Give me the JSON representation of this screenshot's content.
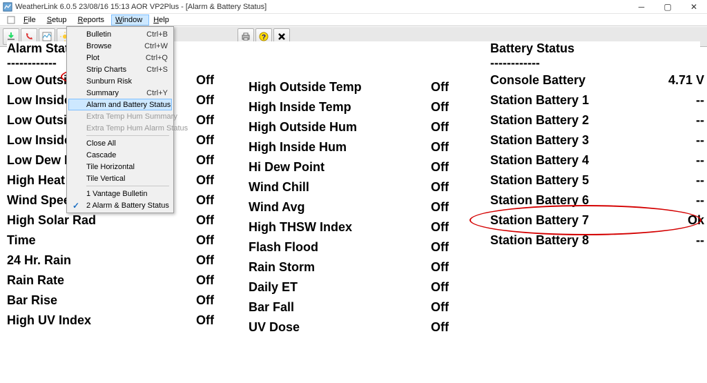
{
  "titlebar": {
    "text": "WeatherLink 6.0.5  23/08/16  15:13  AOR VP2Plus - [Alarm & Battery Status]"
  },
  "menubar": {
    "items": [
      {
        "label": "File",
        "initial": "F"
      },
      {
        "label": "Setup",
        "initial": "S"
      },
      {
        "label": "Reports",
        "initial": "R"
      },
      {
        "label": "Window",
        "initial": "W",
        "open": true
      },
      {
        "label": "Help",
        "initial": "H"
      }
    ]
  },
  "dropdown": [
    {
      "label": "Bulletin",
      "shortcut": "Ctrl+B"
    },
    {
      "label": "Browse",
      "shortcut": "Ctrl+W"
    },
    {
      "label": "Plot",
      "shortcut": "Ctrl+Q"
    },
    {
      "label": "Strip Charts",
      "shortcut": "Ctrl+S"
    },
    {
      "label": "Sunburn Risk"
    },
    {
      "label": "Summary",
      "shortcut": "Ctrl+Y"
    },
    {
      "label": "Alarm and Battery Status",
      "highlight": true
    },
    {
      "label": "Extra Temp Hum Summary",
      "disabled": true
    },
    {
      "label": "Extra Temp Hum Alarm Status",
      "disabled": true
    },
    {
      "sep": true
    },
    {
      "label": "Close All"
    },
    {
      "label": "Cascade"
    },
    {
      "label": "Tile Horizontal"
    },
    {
      "label": "Tile Vertical"
    },
    {
      "sep": true
    },
    {
      "label": "1 Vantage Bulletin"
    },
    {
      "label": "2 Alarm & Battery Status",
      "check": true
    }
  ],
  "alarm_status": {
    "heading": "Alarm Status",
    "dashes": "------------",
    "col1": [
      {
        "label": "Low Outside Temp",
        "value": "Off"
      },
      {
        "label": "Low Inside Temp",
        "value": "Off"
      },
      {
        "label": "Low Outside Hum",
        "value": "Off"
      },
      {
        "label": "Low Inside Hum",
        "value": "Off"
      },
      {
        "label": "Low Dew Point",
        "value": "Off"
      },
      {
        "label": "High Heat",
        "value": "Off"
      },
      {
        "label": "Wind Speed",
        "value": "Off"
      },
      {
        "label": "High Solar Rad",
        "value": "Off"
      },
      {
        "label": "Time",
        "value": "Off"
      },
      {
        "label": "24 Hr. Rain",
        "value": "Off"
      },
      {
        "label": "Rain Rate",
        "value": "Off"
      },
      {
        "label": "Bar Rise",
        "value": "Off"
      },
      {
        "label": "High UV Index",
        "value": "Off"
      }
    ],
    "col2": [
      {
        "label": "High Outside Temp",
        "value": "Off"
      },
      {
        "label": "High Inside Temp",
        "value": "Off"
      },
      {
        "label": "High Outside Hum",
        "value": "Off"
      },
      {
        "label": "High Inside Hum",
        "value": "Off"
      },
      {
        "label": "Hi Dew Point",
        "value": "Off"
      },
      {
        "label": "Wind Chill",
        "value": "Off"
      },
      {
        "label": "Wind Avg",
        "value": "Off"
      },
      {
        "label": "High THSW Index",
        "value": "Off"
      },
      {
        "label": "Flash Flood",
        "value": "Off"
      },
      {
        "label": "Rain Storm",
        "value": "Off"
      },
      {
        "label": "Daily ET",
        "value": "Off"
      },
      {
        "label": "Bar Fall",
        "value": "Off"
      },
      {
        "label": "UV Dose",
        "value": "Off"
      }
    ]
  },
  "battery_status": {
    "heading": "Battery Status",
    "dashes": "------------",
    "rows": [
      {
        "label": "Console Battery",
        "value": "4.71 V"
      },
      {
        "label": "Station Battery 1",
        "value": "--"
      },
      {
        "label": "Station Battery 2",
        "value": "--"
      },
      {
        "label": "Station Battery 3",
        "value": "--"
      },
      {
        "label": "Station Battery 4",
        "value": "--"
      },
      {
        "label": "Station Battery 5",
        "value": "--"
      },
      {
        "label": "Station Battery 6",
        "value": "--"
      },
      {
        "label": "Station Battery 7",
        "value": "Ok"
      },
      {
        "label": "Station Battery 8",
        "value": "--"
      }
    ]
  },
  "toolbar_icons": [
    "download-icon",
    "phone-icon",
    "strip-chart-icon",
    "sun-icon",
    "browse-icon",
    "plot-icon",
    "sun-risk-icon",
    "print-icon",
    "help-icon",
    "close-icon"
  ]
}
